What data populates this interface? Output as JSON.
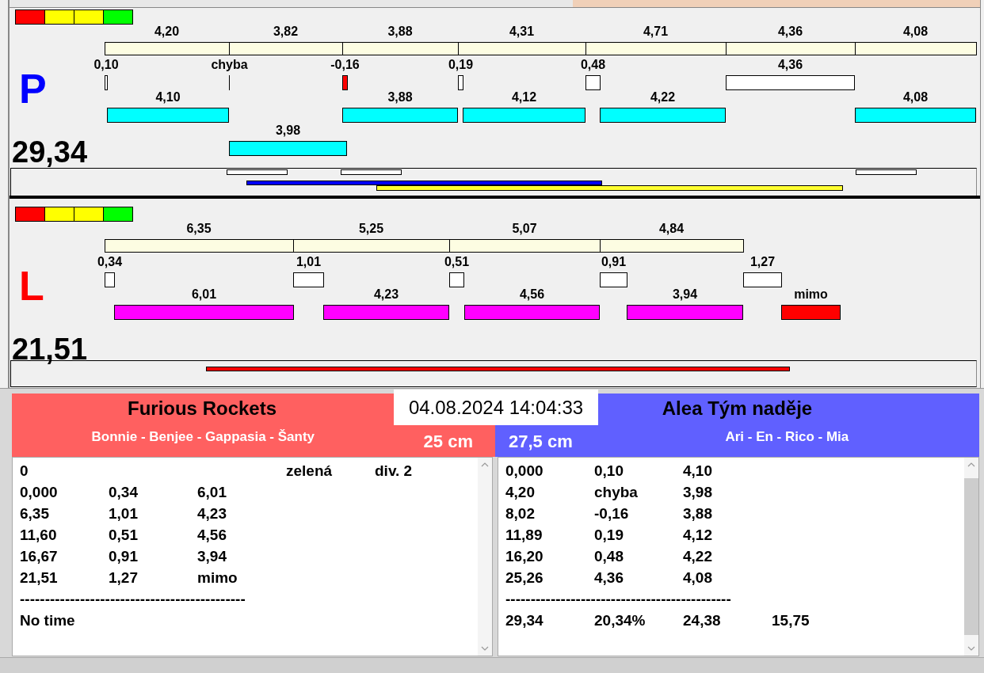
{
  "tracks": [
    {
      "label": "P",
      "color": "#0000ff",
      "total": "29,34",
      "segments": [
        {
          "label": "4,20"
        },
        {
          "label": "3,82"
        },
        {
          "label": "3,88"
        },
        {
          "label": "4,31"
        },
        {
          "label": "4,71"
        },
        {
          "label": "4,36"
        },
        {
          "label": "4,08"
        }
      ],
      "gaps": [
        {
          "label": "0,10",
          "kind": "mark"
        },
        {
          "label": "chyba",
          "kind": "line"
        },
        {
          "label": "-0,16",
          "kind": "fault"
        },
        {
          "label": "0,19",
          "kind": "mark"
        },
        {
          "label": "0,48",
          "kind": "mark"
        },
        {
          "label": "4,36",
          "kind": "mark"
        }
      ],
      "runs": [
        {
          "label": "4,10",
          "color": "#00ffff"
        },
        {
          "label": "3,88",
          "color": "#00ffff"
        },
        {
          "label": "4,12",
          "color": "#00ffff"
        },
        {
          "label": "4,22",
          "color": "#00ffff"
        },
        {
          "label": "4,08",
          "color": "#00ffff"
        },
        {
          "label": "3,98",
          "color": "#00ffff"
        }
      ]
    },
    {
      "label": "L",
      "color": "#ff0000",
      "total": "21,51",
      "segments": [
        {
          "label": "6,35"
        },
        {
          "label": "5,25"
        },
        {
          "label": "5,07"
        },
        {
          "label": "4,84"
        }
      ],
      "gaps": [
        {
          "label": "0,34",
          "kind": "mark"
        },
        {
          "label": "1,01",
          "kind": "mark"
        },
        {
          "label": "0,51",
          "kind": "mark"
        },
        {
          "label": "0,91",
          "kind": "mark"
        },
        {
          "label": "1,27",
          "kind": "mark"
        }
      ],
      "runs": [
        {
          "label": "6,01",
          "color": "#ff00ff"
        },
        {
          "label": "4,23",
          "color": "#ff00ff"
        },
        {
          "label": "4,56",
          "color": "#ff00ff"
        },
        {
          "label": "3,94",
          "color": "#ff00ff"
        },
        {
          "label": "mimo",
          "color": "#ff0000"
        }
      ]
    }
  ],
  "timestamp": "04.08.2024 14:04:33",
  "teams": [
    {
      "name": "Furious Rockets",
      "members": "Bonnie - Benjee - Gappasia - Šanty",
      "distance": "25 cm",
      "color": "#ff6060"
    },
    {
      "name": "Alea Tým naděje",
      "members": "Ari - En - Rico - Mia",
      "distance": "27,5 cm",
      "color": "#6060ff"
    }
  ],
  "logs": [
    {
      "rows": [
        {
          "kind": "info",
          "cells": [
            "0",
            "zelená",
            "div. 2"
          ]
        },
        {
          "kind": "data",
          "cells": [
            "0,000",
            "0,34",
            "6,01"
          ]
        },
        {
          "kind": "data",
          "cells": [
            "6,35",
            "1,01",
            "4,23"
          ]
        },
        {
          "kind": "data",
          "cells": [
            "11,60",
            "0,51",
            "4,56"
          ]
        },
        {
          "kind": "data",
          "cells": [
            "16,67",
            "0,91",
            "3,94"
          ]
        },
        {
          "kind": "data",
          "cells": [
            "21,51",
            "1,27",
            "mimo"
          ]
        },
        {
          "kind": "rule",
          "cells": [
            "---------------------------------------------"
          ]
        },
        {
          "kind": "data",
          "cells": [
            "No time"
          ]
        }
      ]
    },
    {
      "rows": [
        {
          "kind": "data",
          "cells": [
            "0,000",
            "0,10",
            "4,10"
          ]
        },
        {
          "kind": "data",
          "cells": [
            "4,20",
            "chyba",
            "3,98"
          ]
        },
        {
          "kind": "data",
          "cells": [
            "8,02",
            "-0,16",
            "3,88"
          ]
        },
        {
          "kind": "data",
          "cells": [
            "11,89",
            "0,19",
            "4,12"
          ]
        },
        {
          "kind": "data",
          "cells": [
            "16,20",
            "0,48",
            "4,22"
          ]
        },
        {
          "kind": "data",
          "cells": [
            "25,26",
            "4,36",
            "4,08"
          ]
        },
        {
          "kind": "rule",
          "cells": [
            "---------------------------------------------"
          ]
        },
        {
          "kind": "data",
          "cells": [
            "29,34",
            "20,34%",
            "24,38",
            "15,75"
          ]
        }
      ]
    }
  ]
}
